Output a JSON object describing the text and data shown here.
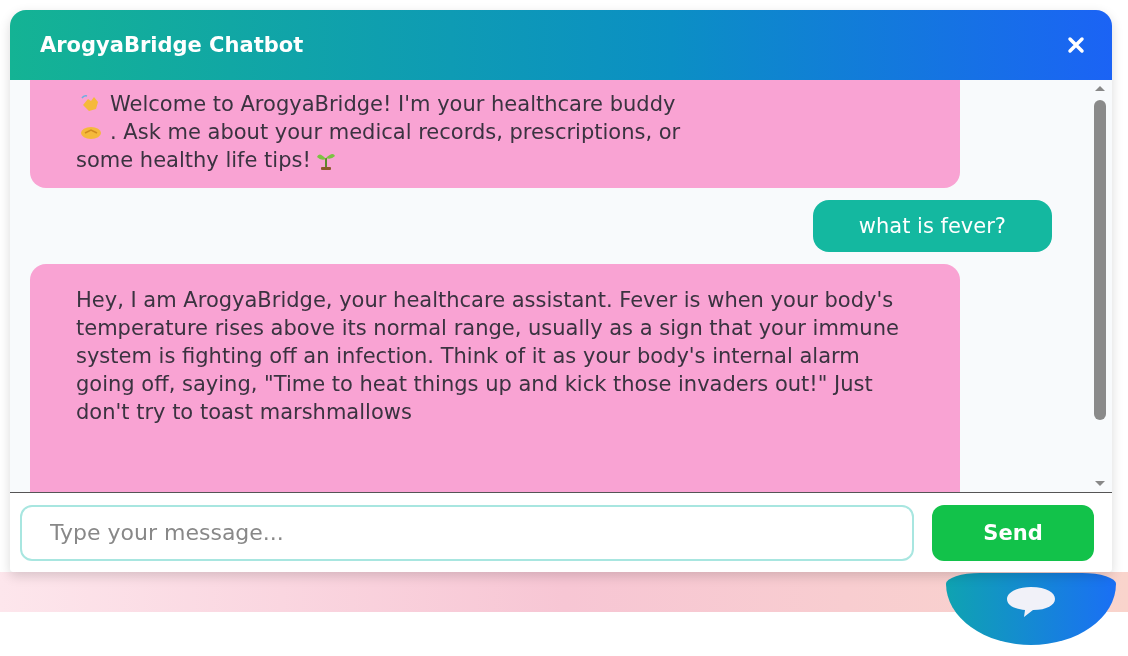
{
  "window": {
    "title": "ArogyaBridge Chatbot"
  },
  "messages": [
    {
      "kind": "bot",
      "lines": [
        [
          {
            "kind": "icon"
          },
          {
            "kind": "text",
            "text": "Welcome to ArogyaBridge! I'm your healthcare buddy"
          }
        ],
        [
          {
            "kind": "icon"
          },
          {
            "kind": "text",
            "text": ". Ask me about your medical records, prescriptions, or"
          }
        ],
        [
          {
            "kind": "text",
            "text": "some healthy life tips!"
          },
          {
            "kind": "icon"
          }
        ]
      ]
    },
    {
      "kind": "user",
      "text": "what is fever?"
    },
    {
      "kind": "bot",
      "text": "Hey, I am ArogyaBridge, your healthcare assistant. Fever is when your body's temperature rises above its normal range, usually as a sign that your immune system is fighting off an infection. Think of it as your body's internal alarm going off, saying, \"Time to heat things up and kick those invaders out!\" Just don't try to toast marshmallows"
    }
  ],
  "input": {
    "placeholder": "Type your message..."
  },
  "send_button": "Send"
}
